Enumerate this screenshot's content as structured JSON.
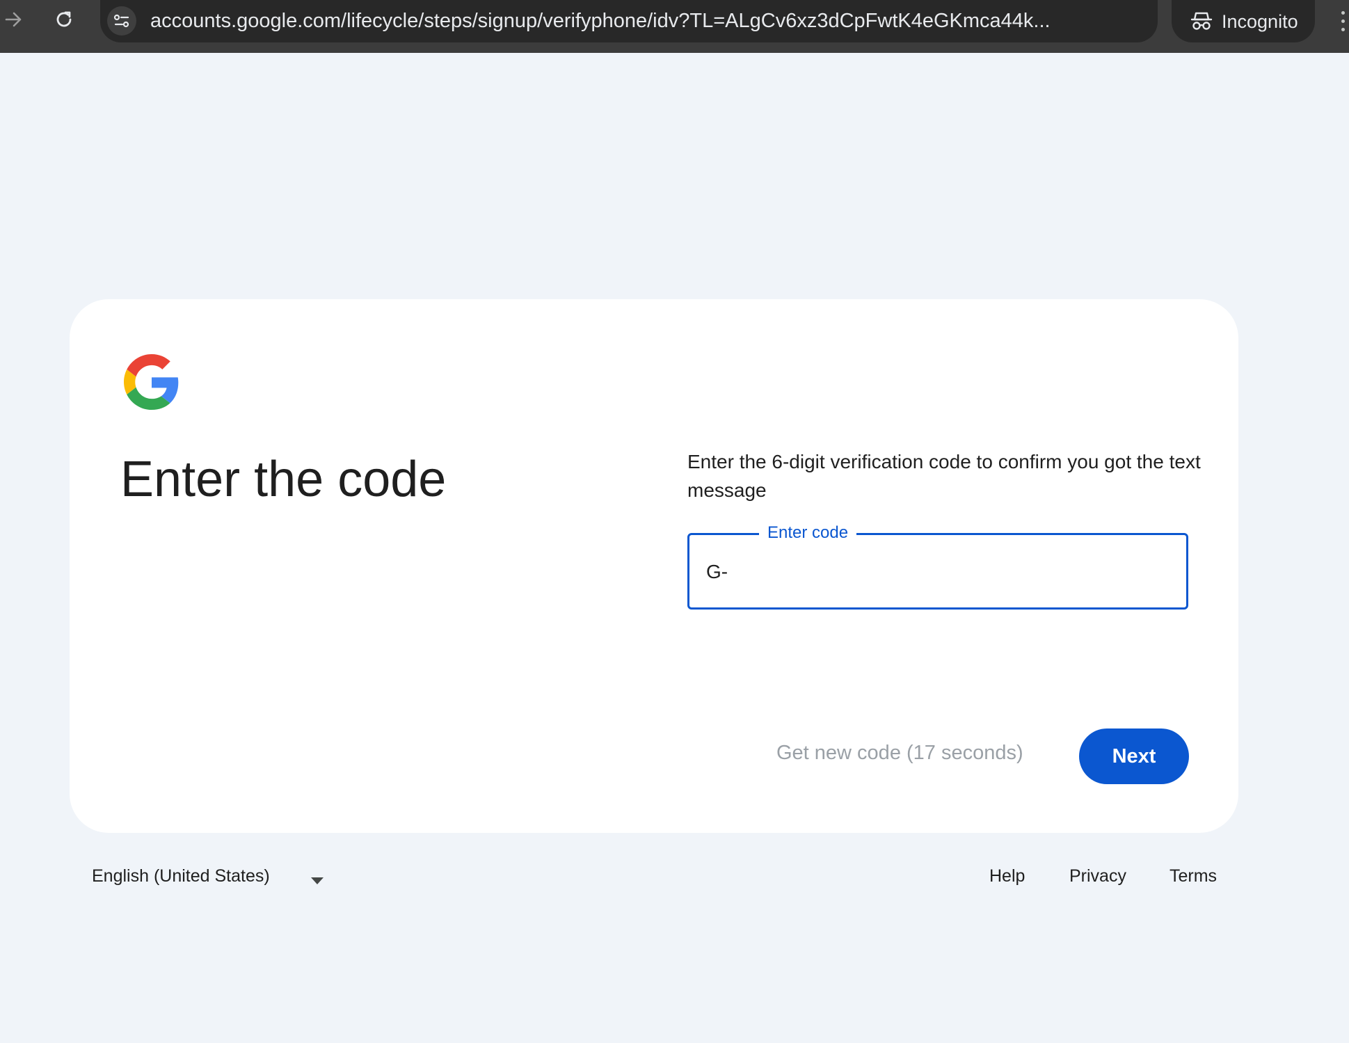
{
  "browser": {
    "url": "accounts.google.com/lifecycle/steps/signup/verifyphone/idv?TL=ALgCv6xz3dCpFwtK4eGKmca44k...",
    "incognito_label": "Incognito",
    "icons": [
      "forward-arrow-icon",
      "reload-icon",
      "site-info-icon",
      "bookmark-star-icon",
      "incognito-icon",
      "more-menu-icon"
    ]
  },
  "card": {
    "logo": "google-g-logo",
    "title": "Enter the code",
    "description": "Enter the 6-digit verification code to confirm you got the text message",
    "code_field": {
      "label": "Enter code",
      "value": "G-"
    },
    "get_new_code": "Get new code (17 seconds)",
    "next_label": "Next"
  },
  "footer": {
    "language": "English (United States)",
    "links": {
      "help": "Help",
      "privacy": "Privacy",
      "terms": "Terms"
    }
  },
  "colors": {
    "page_background": "#f0f4f9",
    "chrome_bar": "#3c3c3c",
    "accent_blue": "#0b57d0",
    "text_primary": "#1f1f1f",
    "text_disabled": "#9aa0a6"
  }
}
